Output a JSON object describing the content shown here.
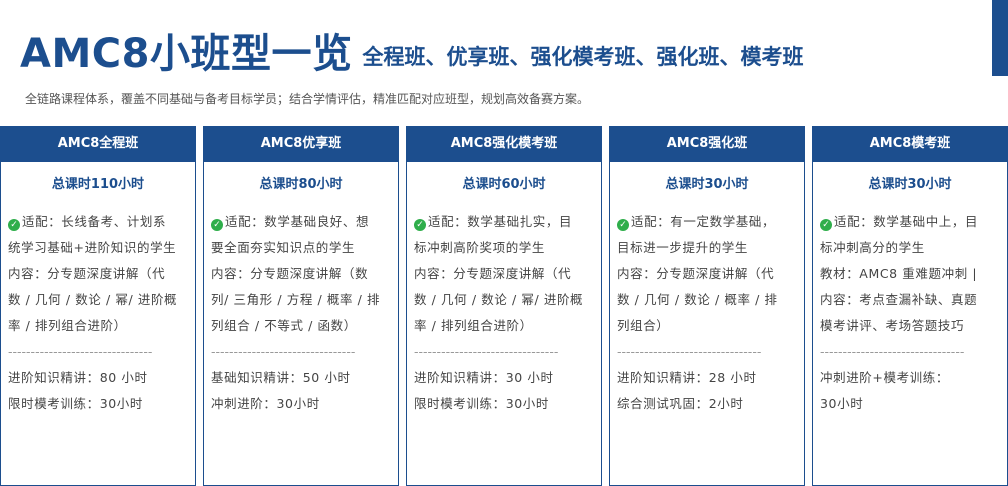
{
  "header": {
    "title": "AMC8小班型一览",
    "subtitle": "全程班、优享班、强化模考班、强化班、模考班",
    "intro": "全链路课程体系，覆盖不同基础与备考目标学员；结合学情评估，精准匹配对应班型，规划高效备赛方案。"
  },
  "cards": [
    {
      "name": "AMC8全程班",
      "hours": "总课时110小时",
      "lines": [
        "适配：长线备考、计划系",
        "统学习基础+进阶知识的学生",
        "内容：分专题深度讲解（代",
        "数 / 几何 / 数论 / 幂/ 进阶概",
        "率 / 排列组合进阶）",
        "--------------------------------",
        "进阶知识精讲：80 小时",
        "限时模考训练：30小时"
      ]
    },
    {
      "name": "AMC8优享班",
      "hours": "总课时80小时",
      "lines": [
        "适配：数学基础良好、想",
        "要全面夯实知识点的学生",
        "内容：分专题深度讲解（数",
        "列/ 三角形 / 方程 / 概率 / 排",
        "列组合 / 不等式 / 函数）",
        "--------------------------------",
        "基础知识精讲：50 小时",
        "冲刺进阶：30小时"
      ]
    },
    {
      "name": "AMC8强化模考班",
      "hours": "总课时60小时",
      "lines": [
        "适配：数学基础扎实，目",
        "标冲刺高阶奖项的学生",
        "内容：分专题深度讲解（代",
        "数 / 几何 / 数论 / 幂/ 进阶概",
        "率 / 排列组合进阶）",
        "--------------------------------",
        "进阶知识精讲：30 小时",
        "限时模考训练：30小时"
      ]
    },
    {
      "name": "AMC8强化班",
      "hours": "总课时30小时",
      "lines": [
        "适配：有一定数学基础，",
        "目标进一步提升的学生",
        "内容：分专题深度讲解（代",
        "数 / 几何 / 数论 / 概率 / 排",
        "列组合）",
        "--------------------------------",
        "进阶知识精讲：28 小时",
        "综合测试巩固：2小时"
      ]
    },
    {
      "name": "AMC8模考班",
      "hours": "总课时30小时",
      "lines": [
        "适配：数学基础中上，目",
        "标冲刺高分的学生",
        "教材：AMC8  重难题冲刺  |",
        "内容：考点查漏补缺、真题",
        "模考讲评、考场答题技巧",
        "--------------------------------",
        "冲刺进阶+模考训练：",
        "30小时"
      ]
    }
  ]
}
